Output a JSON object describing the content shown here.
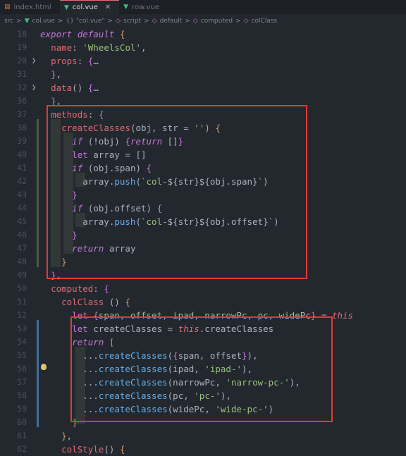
{
  "tabs": [
    {
      "label": "index.html",
      "icon": "html-file-icon",
      "active": false
    },
    {
      "label": "col.vue",
      "icon": "vue-file-icon",
      "active": true
    },
    {
      "label": "row.vue",
      "icon": "vue-file-icon",
      "active": false
    }
  ],
  "breadcrumb": [
    "src",
    ">",
    "col.vue",
    ">",
    "{} \"col.vue\"",
    ">",
    "script",
    ">",
    "default",
    ">",
    "computed",
    ">",
    "colClass"
  ],
  "line_numbers": [
    "18",
    "19",
    "20",
    "31",
    "32",
    "36",
    "37",
    "38",
    "39",
    "40",
    "41",
    "42",
    "43",
    "44",
    "45",
    "46",
    "47",
    "48",
    "49",
    "50",
    "51",
    "52",
    "53",
    "54",
    "55",
    "56",
    "57",
    "58",
    "59",
    "60",
    "61",
    "62"
  ],
  "code_lines": [
    "export default {",
    "  name: 'WheelsCol',",
    "  props: {…",
    "  },",
    "  data() {…",
    "  },",
    "  methods: {",
    "    createClasses(obj, str = '') {",
    "      if (!obj) {return []}",
    "      let array = []",
    "      if (obj.span) {",
    "        array.push(`col-${str}${obj.span}`)",
    "      }",
    "      if (obj.offset) {",
    "        array.push(`col-${str}${obj.offset}`)",
    "      }",
    "      return array",
    "    }",
    "  },",
    "  computed: {",
    "    colClass () {",
    "      let {span, offset, ipad, narrowPc, pc, widePc} = this",
    "      let createClasses = this.createClasses",
    "      return [",
    "        ...createClasses({span, offset}),",
    "        ...createClasses(ipad, 'ipad-'),",
    "        ...createClasses(narrowPc, 'narrow-pc-'),",
    "        ...createClasses(pc, 'pc-'),",
    "        ...createClasses(widePc, 'wide-pc-')",
    "      ]",
    "    },",
    "    colStyle() {"
  ],
  "colors": {
    "keyword": "#c678dd",
    "property": "#e5c07b",
    "function": "#61afef",
    "string": "#98c379",
    "variable": "#e06c75",
    "highlight_box": "#e53935"
  }
}
